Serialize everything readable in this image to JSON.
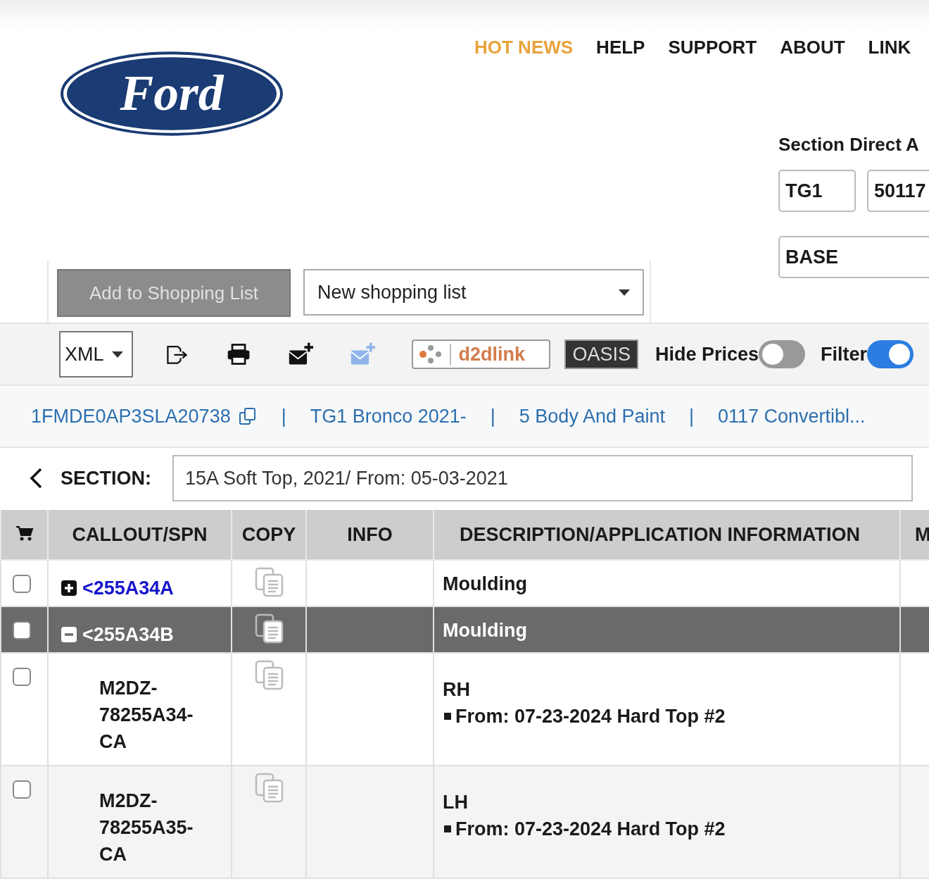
{
  "nav": [
    {
      "label": "HOT NEWS",
      "selected": true
    },
    {
      "label": "HELP",
      "selected": false
    },
    {
      "label": "SUPPORT",
      "selected": false
    },
    {
      "label": "ABOUT",
      "selected": false
    },
    {
      "label": "LINK",
      "selected": false
    }
  ],
  "logo": {
    "text": "Ford"
  },
  "section_direct": {
    "title": "Section Direct A",
    "fields": [
      {
        "value": "TG1"
      },
      {
        "value": "50117"
      },
      {
        "value": "BASE"
      }
    ]
  },
  "shopping": {
    "add_button": "Add to Shopping List",
    "add_disabled": true,
    "list_select": "New shopping list"
  },
  "toolbar": {
    "format_select": "XML",
    "d2dlink": "d2dlink",
    "oasis": "OASIS",
    "toggles": [
      {
        "label": "Hide Prices",
        "on": false
      },
      {
        "label": "Filter",
        "on": true
      }
    ]
  },
  "breadcrumb": [
    {
      "kind": "vin",
      "label": "1FMDE0AP3SLA20738"
    },
    {
      "kind": "separator",
      "label": "|"
    },
    {
      "kind": "link",
      "label": "TG1 Bronco 2021-"
    },
    {
      "kind": "separator",
      "label": "|"
    },
    {
      "kind": "link",
      "label": "5 Body And Paint"
    },
    {
      "kind": "separator",
      "label": "|"
    },
    {
      "kind": "link",
      "label": "0117 Convertibl..."
    }
  ],
  "section": {
    "label": "SECTION:",
    "value": "15A Soft Top, 2021/ From: 05-03-2021"
  },
  "table": {
    "columns": [
      "CALLOUT/SPN",
      "COPY",
      "INFO",
      "DESCRIPTION/APPLICATION INFORMATION",
      "M"
    ],
    "rows": [
      {
        "kind": "group",
        "checked": false,
        "selected": false,
        "expanded": false,
        "callout": "<255A34A",
        "description": "Moulding"
      },
      {
        "kind": "group",
        "checked": false,
        "selected": true,
        "expanded": true,
        "callout": "<255A34B",
        "description": "Moulding"
      },
      {
        "kind": "part",
        "checked": false,
        "selected": false,
        "callout": "M2DZ-78255A34-CA",
        "description": "RH",
        "notes": [
          "From: 07-23-2024 Hard Top #2"
        ]
      },
      {
        "kind": "part",
        "checked": false,
        "selected": false,
        "callout": "M2DZ-78255A35-CA",
        "description": "LH",
        "notes": [
          "From: 07-23-2024 Hard Top #2"
        ]
      }
    ]
  }
}
